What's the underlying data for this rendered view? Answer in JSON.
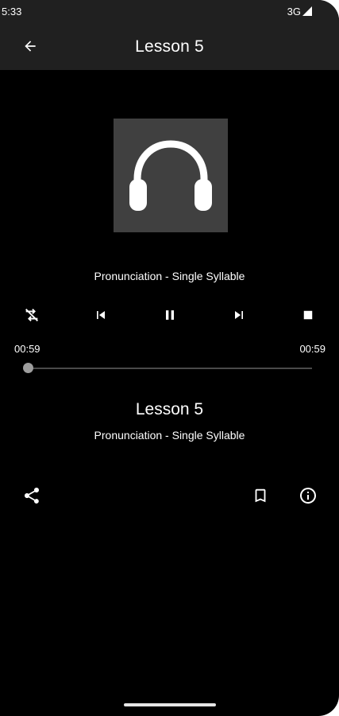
{
  "status_bar": {
    "time": "5:33",
    "network": "3G",
    "icons": [
      "signal-icon"
    ]
  },
  "app_bar": {
    "title": "Lesson 5",
    "back_icon": "arrow-left-icon"
  },
  "player": {
    "artwork_icon": "headphones-icon",
    "track_name": "Pronunciation - Single Syllable",
    "controls": [
      "shuffle-off-icon",
      "skip-previous-icon",
      "pause-icon",
      "skip-next-icon",
      "stop-icon"
    ],
    "elapsed": "00:59",
    "duration": "00:59",
    "progress": 0.0
  },
  "lesson": {
    "title": "Lesson 5",
    "subtitle": "Pronunciation - Single Syllable"
  },
  "actions": [
    "share-icon",
    "bookmark-icon",
    "info-icon"
  ],
  "colors": {
    "background": "#000000",
    "bar": "#202020",
    "artwork_bg": "#404040",
    "text": "#ffffff",
    "seek_track": "#4a4a4a",
    "seek_thumb": "#9e9e9e"
  }
}
